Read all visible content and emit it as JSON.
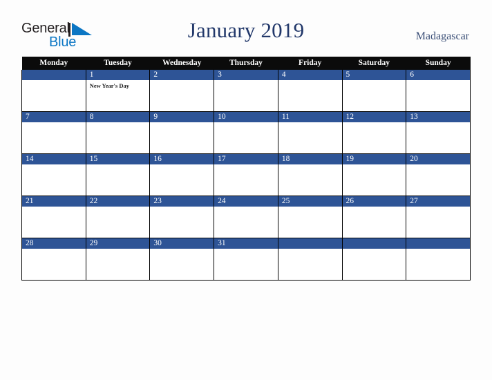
{
  "brand": {
    "name_part1": "General",
    "name_part2": "Blue",
    "triangle_color": "#0b76c4",
    "text_color": "#231f20"
  },
  "header": {
    "title": "January 2019",
    "country": "Madagascar",
    "title_color": "#22386a"
  },
  "calendar": {
    "weekday_headers": [
      "Monday",
      "Tuesday",
      "Wednesday",
      "Thursday",
      "Friday",
      "Saturday",
      "Sunday"
    ],
    "header_bg": "#0b0b0b",
    "date_band_color": "#2e5496",
    "cell_bg": "#ffffff",
    "weeks": [
      [
        {
          "date": "",
          "event": ""
        },
        {
          "date": "1",
          "event": "New Year's Day"
        },
        {
          "date": "2",
          "event": ""
        },
        {
          "date": "3",
          "event": ""
        },
        {
          "date": "4",
          "event": ""
        },
        {
          "date": "5",
          "event": ""
        },
        {
          "date": "6",
          "event": ""
        }
      ],
      [
        {
          "date": "7",
          "event": ""
        },
        {
          "date": "8",
          "event": ""
        },
        {
          "date": "9",
          "event": ""
        },
        {
          "date": "10",
          "event": ""
        },
        {
          "date": "11",
          "event": ""
        },
        {
          "date": "12",
          "event": ""
        },
        {
          "date": "13",
          "event": ""
        }
      ],
      [
        {
          "date": "14",
          "event": ""
        },
        {
          "date": "15",
          "event": ""
        },
        {
          "date": "16",
          "event": ""
        },
        {
          "date": "17",
          "event": ""
        },
        {
          "date": "18",
          "event": ""
        },
        {
          "date": "19",
          "event": ""
        },
        {
          "date": "20",
          "event": ""
        }
      ],
      [
        {
          "date": "21",
          "event": ""
        },
        {
          "date": "22",
          "event": ""
        },
        {
          "date": "23",
          "event": ""
        },
        {
          "date": "24",
          "event": ""
        },
        {
          "date": "25",
          "event": ""
        },
        {
          "date": "26",
          "event": ""
        },
        {
          "date": "27",
          "event": ""
        }
      ],
      [
        {
          "date": "28",
          "event": ""
        },
        {
          "date": "29",
          "event": ""
        },
        {
          "date": "30",
          "event": ""
        },
        {
          "date": "31",
          "event": ""
        },
        {
          "date": "",
          "event": ""
        },
        {
          "date": "",
          "event": ""
        },
        {
          "date": "",
          "event": ""
        }
      ]
    ]
  }
}
